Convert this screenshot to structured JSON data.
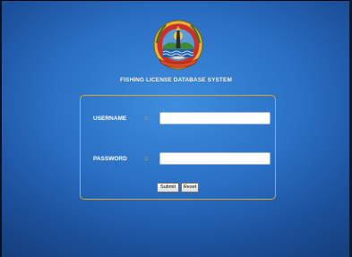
{
  "header": {
    "system_title": "FISHING LICENSE DATABASE SYSTEM",
    "logo_icon": "fisheries-emblem-icon"
  },
  "login_form": {
    "username_label": "USERNAME",
    "username_separator": "::",
    "username_value": "",
    "username_placeholder": "",
    "password_label": "PASSWORD",
    "password_separator": "::",
    "password_value": "",
    "password_placeholder": "",
    "submit_label": "Submit",
    "reset_label": "Reset"
  },
  "colors": {
    "background_accent": "#2a6fc4",
    "form_border": "#d9a52a",
    "label_text": "#ffffff",
    "separator": "#e0b040"
  }
}
